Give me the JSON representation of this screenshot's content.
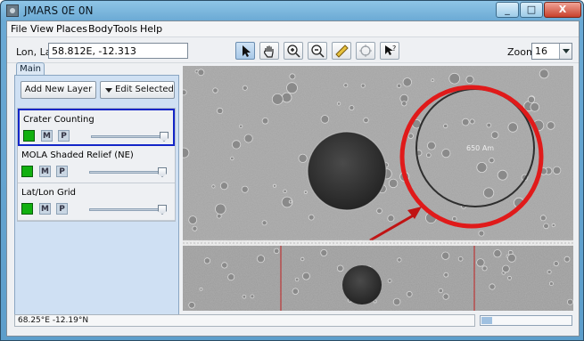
{
  "window": {
    "title": "JMARS 0E 0N",
    "min_label": "_",
    "max_label": "□",
    "close_label": "X"
  },
  "menu": [
    {
      "label": "File"
    },
    {
      "label": "View"
    },
    {
      "label": "Places"
    },
    {
      "label": "Body"
    },
    {
      "label": "Tools"
    },
    {
      "label": "Help"
    }
  ],
  "toolbar": {
    "lonlat_label": "Lon, Lat",
    "lonlat_value": "58.812E, -12.313",
    "tools": [
      "pointer-tool-icon",
      "pan-hand-icon",
      "zoom-in-icon",
      "zoom-out-icon",
      "ruler-icon",
      "crater-tool-icon",
      "investigate-tool-icon"
    ],
    "zoom_label": "Zoom:",
    "zoom_value": "16"
  },
  "panel": {
    "tab": "Main",
    "add_layer": "Add New Layer",
    "edit_selected": "Edit Selected",
    "layers": [
      {
        "name": "Crater Counting",
        "m": "M",
        "p": "P",
        "opacity": 1.0,
        "selected": true
      },
      {
        "name": "MOLA Shaded Relief (NE)",
        "m": "M",
        "p": "P",
        "opacity": 1.0,
        "selected": false
      },
      {
        "name": "Lat/Lon Grid",
        "m": "M",
        "p": "P",
        "opacity": 1.0,
        "selected": false
      }
    ]
  },
  "map": {
    "crater_label": "650 Am",
    "annotation_color": "#e01a1a"
  },
  "status": {
    "coords": "68.25°E -12.19°N",
    "progress": 0.12
  }
}
